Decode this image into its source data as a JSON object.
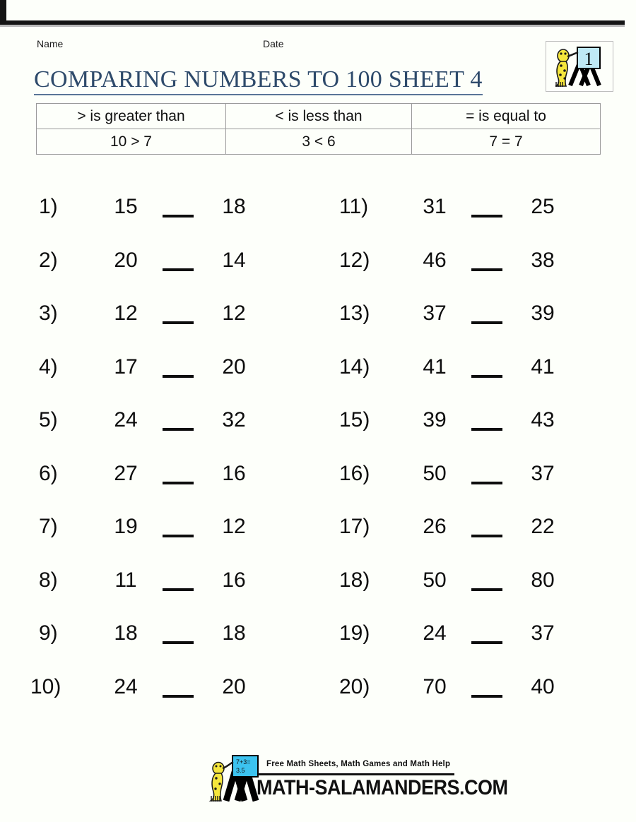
{
  "header": {
    "name_label": "Name",
    "date_label": "Date",
    "title": "COMPARING NUMBERS TO 100 SHEET 4",
    "badge_grade": "1",
    "badge_icon": "salamander-easel-icon"
  },
  "legend": {
    "symbols": [
      {
        "description": "> is greater than",
        "example": "10 > 7"
      },
      {
        "description": "< is less than",
        "example": "3 < 6"
      },
      {
        "description": "= is equal to",
        "example": "7 = 7"
      }
    ]
  },
  "problems": {
    "left_column": [
      {
        "number": "1)",
        "left": "15",
        "right": "18"
      },
      {
        "number": "2)",
        "left": "20",
        "right": "14"
      },
      {
        "number": "3)",
        "left": "12",
        "right": "12"
      },
      {
        "number": "4)",
        "left": "17",
        "right": "20"
      },
      {
        "number": "5)",
        "left": "24",
        "right": "32"
      },
      {
        "number": "6)",
        "left": "27",
        "right": "16"
      },
      {
        "number": "7)",
        "left": "19",
        "right": "12"
      },
      {
        "number": "8)",
        "left": "11",
        "right": "16"
      },
      {
        "number": "9)",
        "left": "18",
        "right": "18"
      },
      {
        "number": "10)",
        "left": "24",
        "right": "20"
      }
    ],
    "right_column": [
      {
        "number": "11)",
        "left": "31",
        "right": "25"
      },
      {
        "number": "12)",
        "left": "46",
        "right": "38"
      },
      {
        "number": "13)",
        "left": "37",
        "right": "39"
      },
      {
        "number": "14)",
        "left": "41",
        "right": "41"
      },
      {
        "number": "15)",
        "left": "39",
        "right": "43"
      },
      {
        "number": "16)",
        "left": "50",
        "right": "37"
      },
      {
        "number": "17)",
        "left": "26",
        "right": "22"
      },
      {
        "number": "18)",
        "left": "50",
        "right": "80"
      },
      {
        "number": "19)",
        "left": "24",
        "right": "37"
      },
      {
        "number": "20)",
        "left": "70",
        "right": "40"
      }
    ]
  },
  "footer": {
    "tagline": "Free Math Sheets, Math Games and Math Help",
    "domain": "MATH-SALAMANDERS.COM",
    "mascot_icon": "salamander-chalkboard-icon"
  },
  "colors": {
    "title": "#2e4a6b",
    "text": "#0d0d0d",
    "table_border": "#9a9a9a",
    "mascot_body": "#f5e63c",
    "chalkboard": "#3cc3f0",
    "badge_board": "#bfe9f5",
    "page_background": "#fdfffa"
  }
}
